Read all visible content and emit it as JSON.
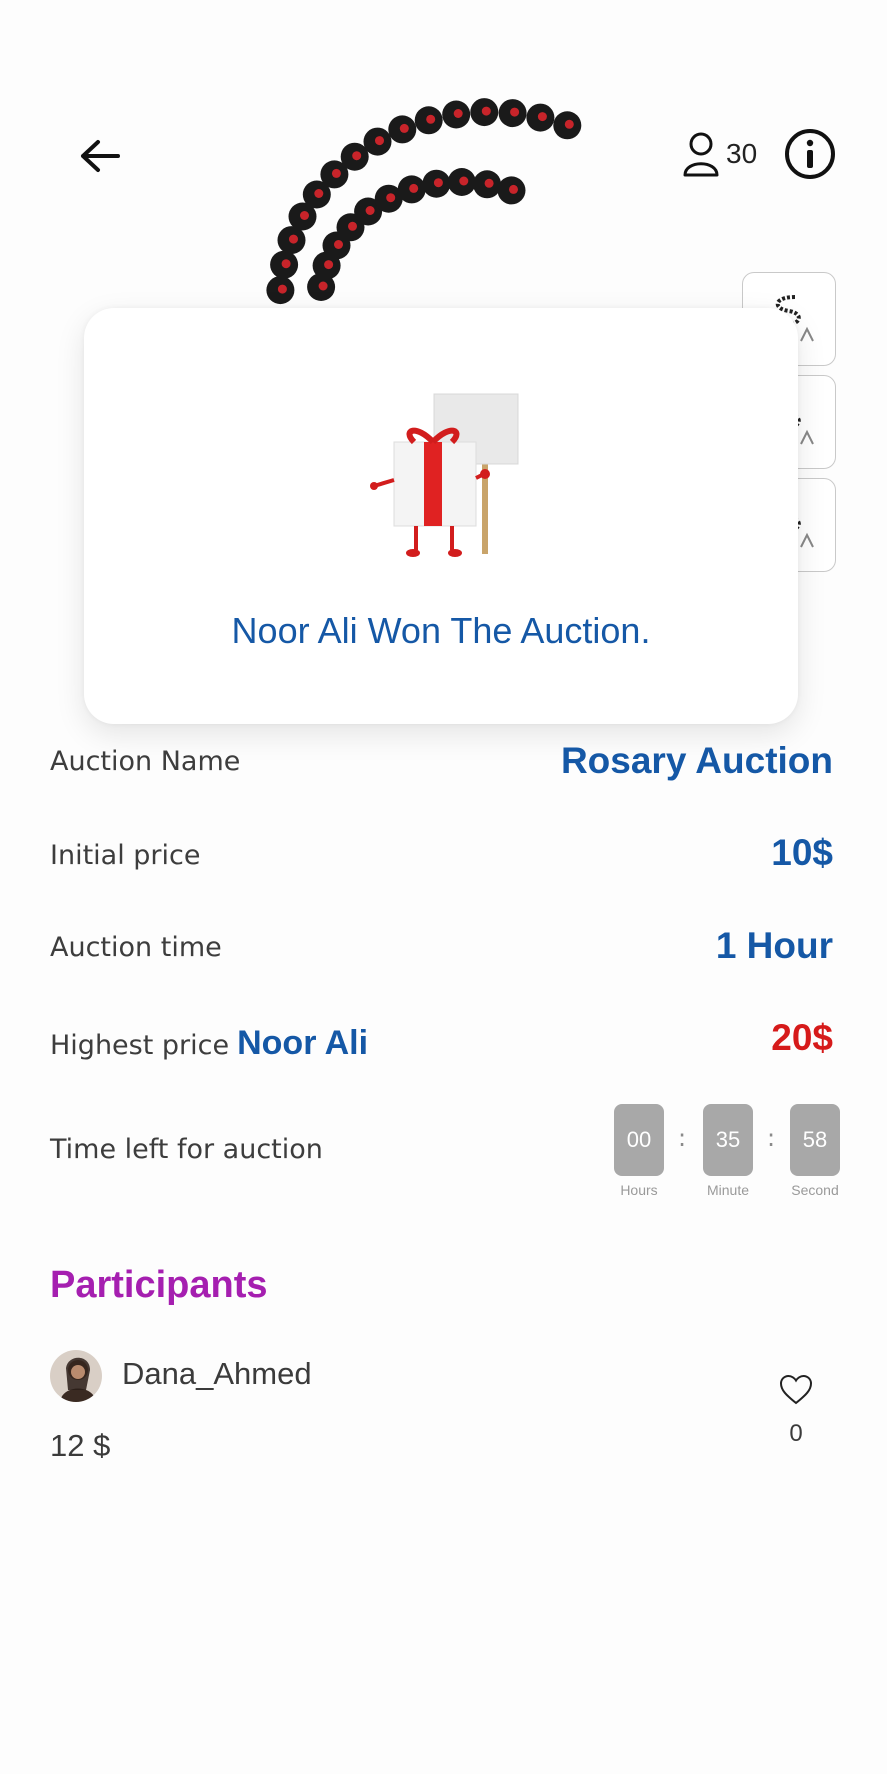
{
  "header": {
    "participants_count": "30",
    "back_icon": "arrow-left-icon",
    "user_icon": "user-outline-icon",
    "info_icon": "info-circle-icon"
  },
  "winner": {
    "message": "Noor Ali Won The Auction."
  },
  "details": {
    "name_label": "Auction Name",
    "name_value": "Rosary Auction",
    "initial_label": "Initial price",
    "initial_value": "10$",
    "time_label": "Auction time",
    "time_value": "1 Hour",
    "highest_label": "Highest price",
    "highest_name": "Noor Ali",
    "highest_value": "20$",
    "time_left_label": "Time left for auction"
  },
  "countdown": {
    "hours": "00",
    "minutes": "35",
    "seconds": "58",
    "hours_label": "Hours",
    "minutes_label": "Minute",
    "seconds_label": "Second",
    "separator": ":"
  },
  "participants": {
    "title": "Participants",
    "items": [
      {
        "name": "Dana_Ahmed",
        "bid": "12 $",
        "likes": "0"
      }
    ]
  },
  "colors": {
    "accent_blue": "#1558a6",
    "price_red": "#d61a1a",
    "participants_purple": "#a51fb0",
    "countdown_gray": "#a8a8a8"
  }
}
